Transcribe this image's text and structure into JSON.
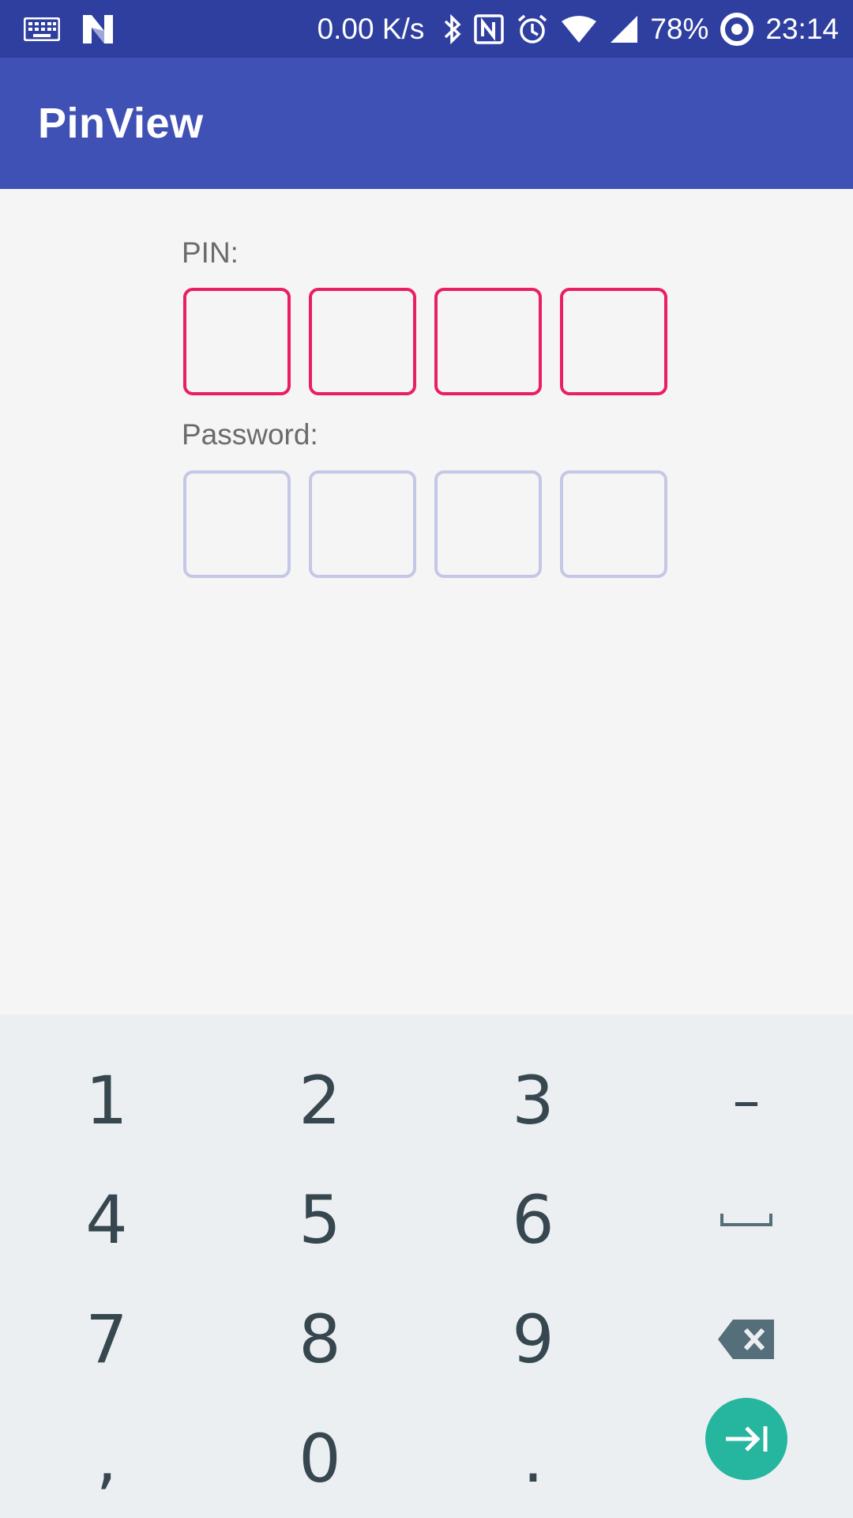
{
  "status_bar": {
    "net_speed": "0.00 K/s",
    "battery": "78%",
    "time": "23:14",
    "icons": [
      "keyboard-icon",
      "n-logo-icon",
      "bluetooth-icon",
      "nfc-icon",
      "alarm-icon",
      "wifi-icon",
      "signal-icon",
      "battery-saver-icon"
    ]
  },
  "app_bar": {
    "title": "PinView"
  },
  "pin": {
    "label": "PIN:",
    "boxes": [
      "",
      "",
      "",
      ""
    ],
    "color": "#e91e63"
  },
  "password": {
    "label": "Password:",
    "boxes": [
      "",
      "",
      "",
      ""
    ],
    "color": "#c5c7e6"
  },
  "keyboard": {
    "rows": [
      [
        "1",
        "2",
        "3",
        "–"
      ],
      [
        "4",
        "5",
        "6",
        "space-icon"
      ],
      [
        "7",
        "8",
        "9",
        "backspace-icon"
      ],
      [
        ",",
        "0",
        ".",
        "next-icon"
      ]
    ],
    "accent": "#26b59e"
  }
}
